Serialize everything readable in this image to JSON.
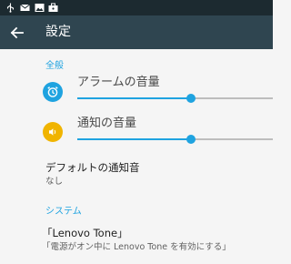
{
  "status_bar": {
    "icons": [
      "usb-icon",
      "mail-icon",
      "image-icon",
      "briefcase-icon"
    ]
  },
  "app_bar": {
    "title": "設定",
    "back_icon": "arrow-left-icon"
  },
  "colors": {
    "accent": "#1fa3e0",
    "app_bar": "#2f4550",
    "status_bar": "#1c2a30",
    "alarm_icon_bg": "#1fa3e0",
    "notification_icon_bg": "#f0b400"
  },
  "sections": {
    "general": {
      "header": "全般",
      "alarm_volume": {
        "title": "アラームの音量",
        "icon": "alarm-clock-icon",
        "level": 0.58
      },
      "notification_volume": {
        "title": "通知の音量",
        "icon": "speaker-icon",
        "level": 0.58
      },
      "default_ringtone": {
        "title": "デフォルトの通知音",
        "summary": "なし"
      }
    },
    "system": {
      "header": "システム",
      "lenovo_tone": {
        "title": "「Lenovo Tone」",
        "summary": "「電源がオン中に Lenovo Tone を有効にする」"
      }
    }
  }
}
